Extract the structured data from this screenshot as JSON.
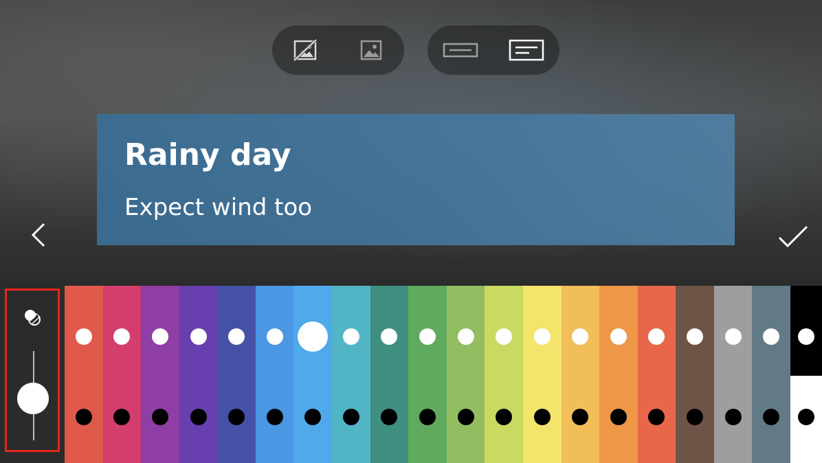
{
  "toolbar": {
    "left_group": [
      "no-background-icon",
      "image-background-icon"
    ],
    "right_group": [
      "bar-style-icon",
      "text-box-style-icon"
    ]
  },
  "caption": {
    "title": "Rainy day",
    "subtitle": "Expect wind too"
  },
  "nav": {
    "back_icon": "chevron-left-icon",
    "confirm_icon": "checkmark-icon"
  },
  "opacity": {
    "icon": "opacity-icon",
    "level": 0.5
  },
  "palette": {
    "colors": [
      "#e05a4c",
      "#d43e6c",
      "#8e3ea4",
      "#673fae",
      "#4451a6",
      "#4b97e4",
      "#4fa9eb",
      "#52b5c6",
      "#3e8f80",
      "#5faa5e",
      "#92bd60",
      "#cad962",
      "#f3e46c",
      "#f2be5a",
      "#ee9747",
      "#e8674a",
      "#6e5446",
      "#9e9e9e",
      "#617a86",
      "#000000"
    ],
    "selected_index": 6,
    "text_color_options": [
      "white",
      "black"
    ]
  }
}
